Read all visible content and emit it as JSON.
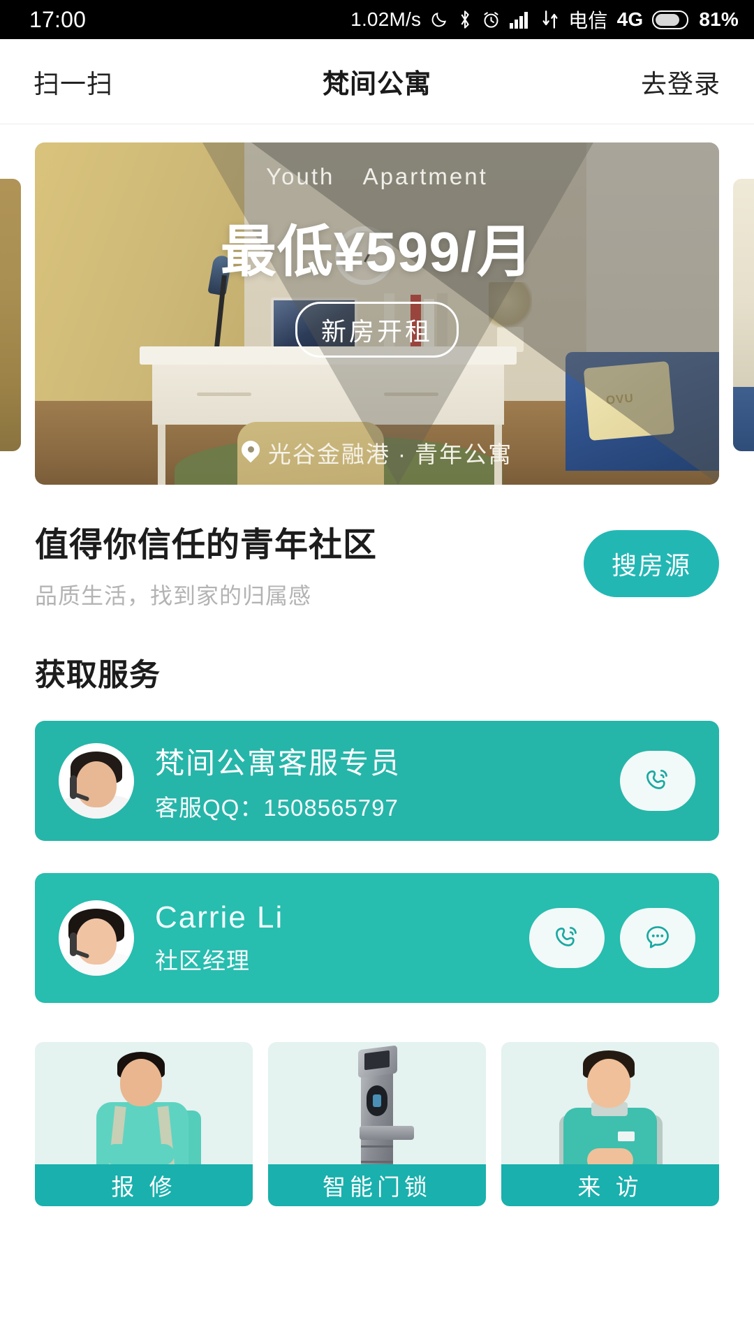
{
  "status_bar": {
    "time": "17:00",
    "net_speed": "1.02M/s",
    "icons": [
      "moon-icon",
      "bluetooth-icon",
      "alarm-icon",
      "signal-icon",
      "data-transfer-icon"
    ],
    "carrier": "电信",
    "network_type": "4G",
    "battery_percent": "81%"
  },
  "nav": {
    "left_action": "扫一扫",
    "title": "梵间公寓",
    "right_action": "去登录"
  },
  "banner": {
    "english_line": [
      "Youth",
      "Apartment"
    ],
    "price_text": "最低¥599/月",
    "cta_label": "新房开租",
    "location": "光谷金融港 · 青年公寓"
  },
  "headline": {
    "title": "值得你信任的青年社区",
    "subtitle": "品质生活，找到家的归属感",
    "search_button": "搜房源"
  },
  "services": {
    "section_title": "获取服务",
    "cards": [
      {
        "name": "梵间公寓客服专员",
        "sub": "客服QQ：1508565797",
        "actions": [
          "phone-icon"
        ]
      },
      {
        "name": "Carrie Li",
        "sub": "社区经理",
        "actions": [
          "phone-icon",
          "message-icon"
        ]
      }
    ]
  },
  "tiles": [
    {
      "label": "报 修",
      "art": "repair-worker-image"
    },
    {
      "label": "智能门锁",
      "art": "smart-lock-image"
    },
    {
      "label": "来 访",
      "art": "visitor-staff-image"
    }
  ],
  "colors": {
    "accent_teal": "#23b7b4",
    "card_teal": "#26b5a9",
    "card_teal_2": "#27bdaf",
    "tile_label_teal": "#19b0ad",
    "tile_bg": "#e4f2f0",
    "text_dark": "#1c1c1c",
    "text_muted": "#b3b3b3",
    "status_bar_bg": "#000000"
  }
}
